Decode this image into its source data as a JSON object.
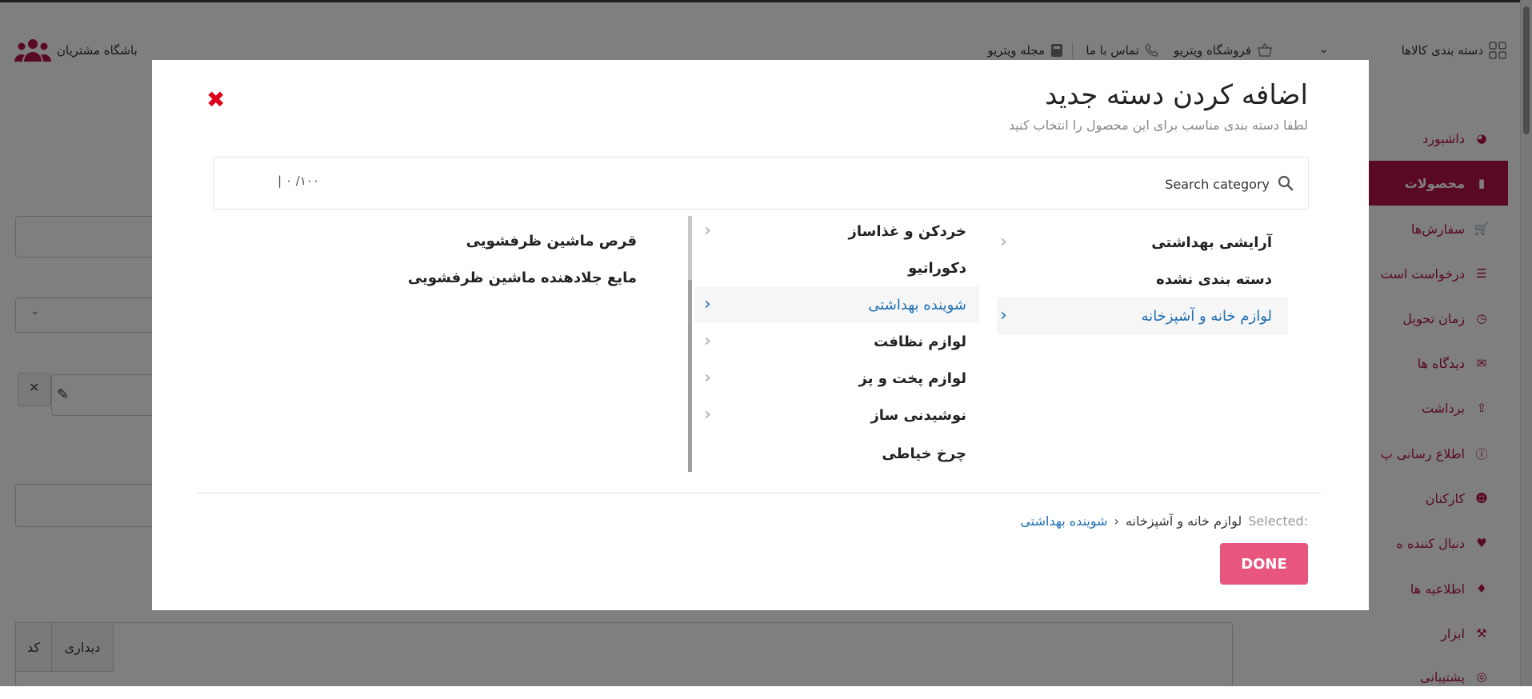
{
  "topbar": {
    "categories_label": "دسته بندی کالاها",
    "store_label": "فروشگاه ویتریو",
    "contact_label": "تماس با ما",
    "magazine_label": "مجله ویتریو",
    "customer_club_label": "باشگاه مشتریان"
  },
  "sidebar": {
    "items": [
      {
        "label": "داشبورد",
        "icon": "dashboard-icon"
      },
      {
        "label": "محصولات",
        "icon": "briefcase-icon"
      },
      {
        "label": "سفارش‌ها",
        "icon": "cart-icon"
      },
      {
        "label": "درخواست است",
        "icon": "list-icon"
      },
      {
        "label": "زمان تحویل",
        "icon": "clock-icon"
      },
      {
        "label": "دیدگاه ها",
        "icon": "comments-icon"
      },
      {
        "label": "برداشت",
        "icon": "upload-icon"
      },
      {
        "label": "اطلاع رسانی پ",
        "icon": "question-icon"
      },
      {
        "label": "کارکنان",
        "icon": "users-icon"
      },
      {
        "label": "دنبال کننده ه",
        "icon": "heart-icon"
      },
      {
        "label": "اطلاعیه ها",
        "icon": "bell-icon"
      },
      {
        "label": "ابزار",
        "icon": "wrench-icon"
      },
      {
        "label": "پشتیبانی",
        "icon": "lifebuoy-icon"
      }
    ]
  },
  "bottom_tabs": [
    "دیداری",
    "کد"
  ],
  "modal": {
    "title": "اضافه کردن دسته جدید",
    "subtitle": "لطفا دسته بندی مناسب برای این محصول را انتخاب کنید",
    "search": {
      "placeholder": "Search category",
      "counter": "| ۰ /۱۰۰"
    },
    "column1": [
      {
        "label": "آرایشی بهداشتی",
        "has_children": true,
        "selected": false
      },
      {
        "label": "دسته بندی نشده",
        "has_children": false,
        "selected": false
      },
      {
        "label": "لوازم خانه و آشپزخانه",
        "has_children": true,
        "selected": true
      }
    ],
    "column2": [
      {
        "label": "خردکن و غذاساز",
        "has_children": true,
        "selected": false
      },
      {
        "label": "دکوراتیو",
        "has_children": false,
        "selected": false
      },
      {
        "label": "شوینده بهداشتی",
        "has_children": true,
        "selected": true
      },
      {
        "label": "لوازم نظافت",
        "has_children": true,
        "selected": false
      },
      {
        "label": "لوازم پخت و پز",
        "has_children": true,
        "selected": false
      },
      {
        "label": "نوشیدنی ساز",
        "has_children": true,
        "selected": false
      },
      {
        "label": "چرخ خیاطی",
        "has_children": false,
        "selected": false
      }
    ],
    "column3": [
      {
        "label": "قرص ماشین ظرفشویی",
        "has_children": false,
        "selected": false
      },
      {
        "label": "مایع جلادهنده ماشین ظرفشویی",
        "has_children": false,
        "selected": false
      }
    ],
    "selected": {
      "label": "Selected:",
      "path": [
        "لوازم خانه و آشپزخانه",
        "شوینده بهداشتی"
      ]
    },
    "done_label": "DONE"
  },
  "colors": {
    "brand": "#b3124a",
    "selected_text": "#1e6fb5",
    "done_button": "#e8567f",
    "close": "#e0001b"
  }
}
